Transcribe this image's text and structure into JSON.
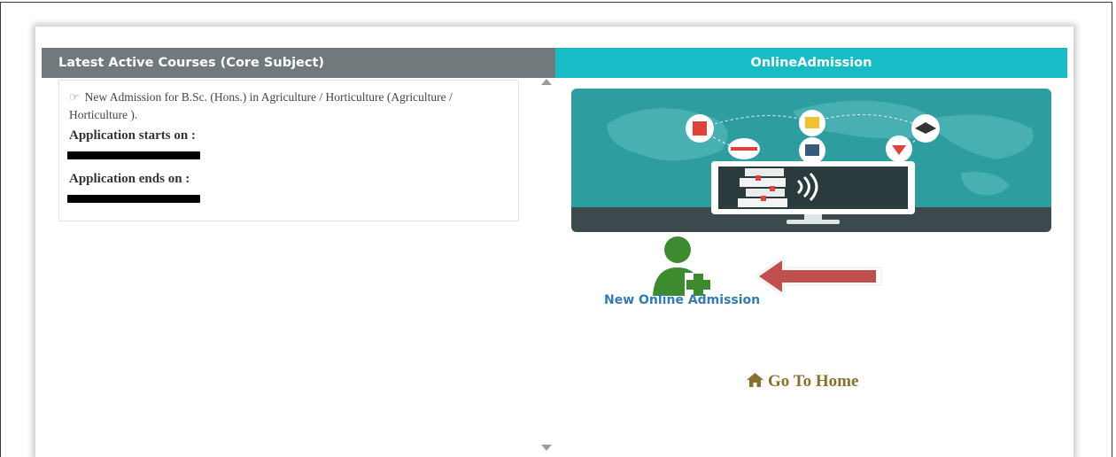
{
  "left_panel": {
    "header": "Latest Active Courses (Core Subject)",
    "course": {
      "title": "New Admission for B.Sc. (Hons.) in Agriculture / Horticulture (Agriculture / Horticulture ).",
      "start_label": "Application starts on :",
      "end_label": "Application ends on :"
    }
  },
  "right_panel": {
    "header": "OnlineAdmission",
    "new_admission_label": "New Online Admission",
    "home_label": "Go To Home"
  },
  "colors": {
    "left_header_bg": "#707a7c",
    "right_header_bg": "#17bcc6",
    "link_blue": "#337ab7",
    "home_gold": "#8b6f2e",
    "icon_green": "#3d8b2f",
    "arrow_red": "#c0504d"
  },
  "icons": {
    "hand": "hand-pointing-right-icon",
    "user_add": "user-add-icon",
    "home": "home-icon"
  }
}
